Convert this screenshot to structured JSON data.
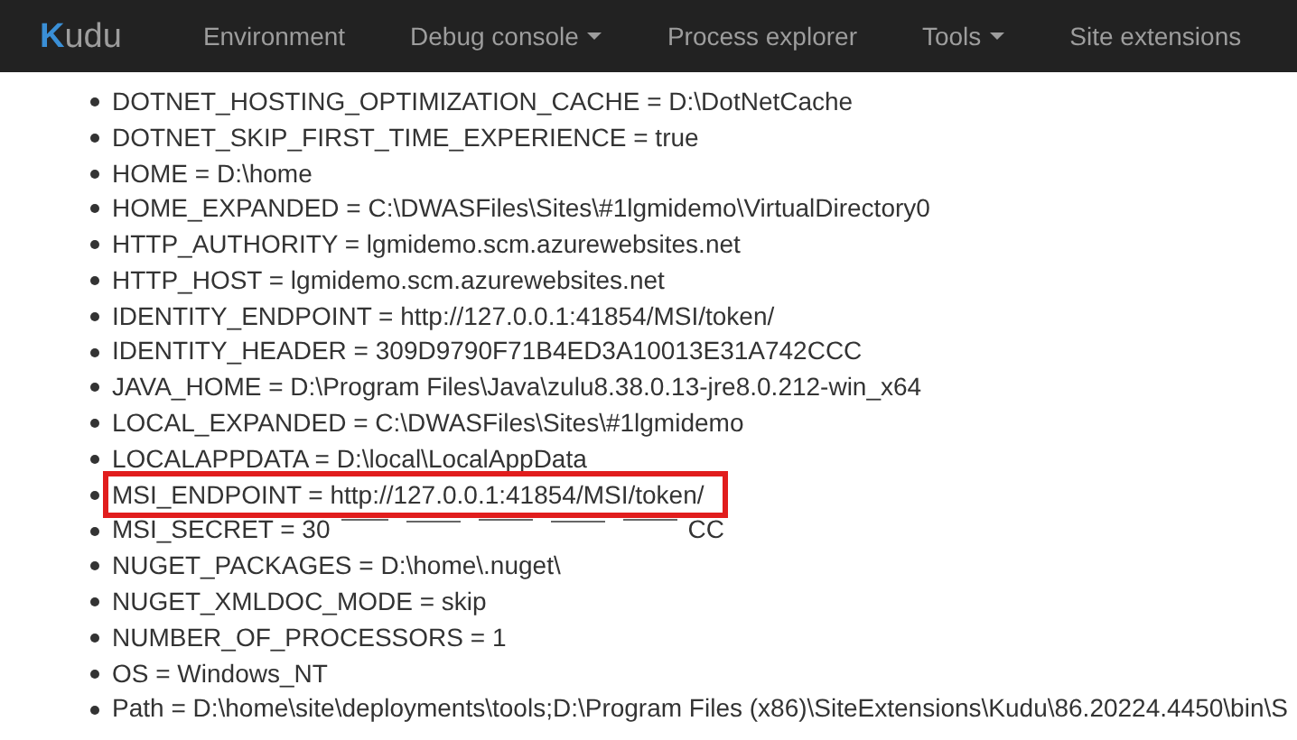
{
  "navbar": {
    "brand": "Kudu",
    "items": [
      {
        "label": "Environment",
        "dropdown": false
      },
      {
        "label": "Debug console",
        "dropdown": true
      },
      {
        "label": "Process explorer",
        "dropdown": false
      },
      {
        "label": "Tools",
        "dropdown": true
      },
      {
        "label": "Site extensions",
        "dropdown": false
      }
    ]
  },
  "variables": [
    {
      "kind": "plain",
      "text": "DOTNET_HOSTING_OPTIMIZATION_CACHE = D:\\DotNetCache",
      "highlighted": false
    },
    {
      "kind": "plain",
      "text": "DOTNET_SKIP_FIRST_TIME_EXPERIENCE = true",
      "highlighted": false
    },
    {
      "kind": "plain",
      "text": "HOME = D:\\home",
      "highlighted": false
    },
    {
      "kind": "plain",
      "text": "HOME_EXPANDED = C:\\DWASFiles\\Sites\\#1lgmidemo\\VirtualDirectory0",
      "highlighted": false
    },
    {
      "kind": "plain",
      "text": "HTTP_AUTHORITY = lgmidemo.scm.azurewebsites.net",
      "highlighted": false
    },
    {
      "kind": "plain",
      "text": "HTTP_HOST = lgmidemo.scm.azurewebsites.net",
      "highlighted": false
    },
    {
      "kind": "plain",
      "text": "IDENTITY_ENDPOINT = http://127.0.0.1:41854/MSI/token/",
      "highlighted": false
    },
    {
      "kind": "plain",
      "text": "IDENTITY_HEADER = 309D9790F71B4ED3A10013E31A742CCC",
      "highlighted": false
    },
    {
      "kind": "plain",
      "text": "JAVA_HOME = D:\\Program Files\\Java\\zulu8.38.0.13-jre8.0.212-win_x64",
      "highlighted": false
    },
    {
      "kind": "plain",
      "text": "LOCAL_EXPANDED = C:\\DWASFiles\\Sites\\#1lgmidemo",
      "highlighted": false
    },
    {
      "kind": "plain",
      "text": "LOCALAPPDATA = D:\\local\\LocalAppData",
      "highlighted": false
    },
    {
      "kind": "plain",
      "text": "MSI_ENDPOINT = http://127.0.0.1:41854/MSI/token/",
      "highlighted": true
    },
    {
      "kind": "redacted",
      "text": "MSI_SECRET = 30",
      "text_end": "CC",
      "highlighted": false
    },
    {
      "kind": "plain",
      "text": "NUGET_PACKAGES = D:\\home\\.nuget\\",
      "highlighted": false
    },
    {
      "kind": "plain",
      "text": "NUGET_XMLDOC_MODE = skip",
      "highlighted": false
    },
    {
      "kind": "plain",
      "text": "NUMBER_OF_PROCESSORS = 1",
      "highlighted": false
    },
    {
      "kind": "plain",
      "text": "OS = Windows_NT",
      "highlighted": false
    },
    {
      "kind": "plain",
      "text": "Path = D:\\home\\site\\deployments\\tools;D:\\Program Files (x86)\\SiteExtensions\\Kudu\\86.20224.4450\\bin\\S",
      "highlighted": false
    }
  ]
}
